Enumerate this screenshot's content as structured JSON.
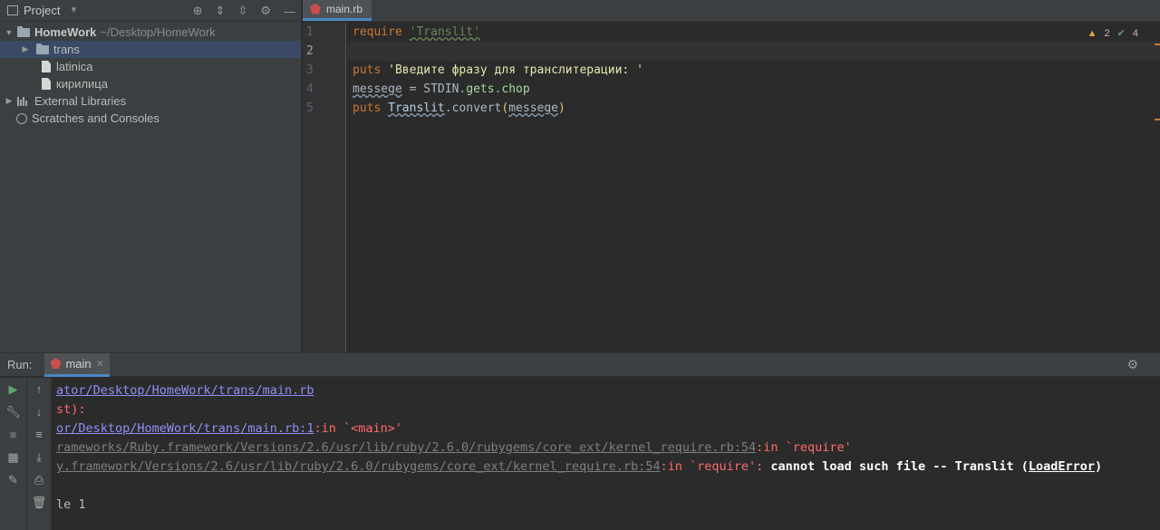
{
  "project": {
    "title": "Project",
    "root": {
      "name": "HomeWork",
      "path": "~/Desktop/HomeWork"
    },
    "items": [
      {
        "label": "trans",
        "type": "folder",
        "selected": true
      },
      {
        "label": "latinica",
        "type": "file"
      },
      {
        "label": "кирилица",
        "type": "file"
      }
    ],
    "external_libraries": "External Libraries",
    "scratches": "Scratches and Consoles"
  },
  "editor": {
    "tab": "main.rb",
    "inspections": {
      "warnings": "2",
      "ok": "4"
    },
    "line_numbers": [
      "1",
      "2",
      "3",
      "4",
      "5"
    ],
    "lines": {
      "l1": {
        "kw": "require",
        "str": "'Translit'"
      },
      "l3": {
        "kw": "puts",
        "str": "'Введите фразу для транслитерации: '"
      },
      "l4": {
        "var": "messege",
        "op": " = ",
        "const": "STDIN",
        "dot1": ".",
        "m1": "gets",
        "dot2": ".",
        "m2": "chop"
      },
      "l5": {
        "kw": "puts",
        "const": "Translit",
        "dot": ".",
        "method": "convert",
        "open": "(",
        "arg": "messege",
        "close": ")"
      }
    }
  },
  "run": {
    "label": "Run:",
    "tab": "main",
    "console": {
      "l1": "ator/Desktop/HomeWork/trans/main.rb",
      "l2": "st):",
      "l3_path": "or/Desktop/HomeWork/trans/main.rb:1",
      "l3_rest": ":in `<main>'",
      "l4_path": "rameworks/Ruby.framework/Versions/2.6/usr/lib/ruby/2.6.0/rubygems/core_ext/kernel_require.rb:54",
      "l4_rest": ":in `require'",
      "l5_path": "y.framework/Versions/2.6/usr/lib/ruby/2.6.0/rubygems/core_ext/kernel_require.rb:54",
      "l5_rest": ":in `require': ",
      "l5_msg": "cannot load such file -- Translit (",
      "l5_link": "LoadError",
      "l5_end": ")",
      "l7": "le 1"
    }
  }
}
